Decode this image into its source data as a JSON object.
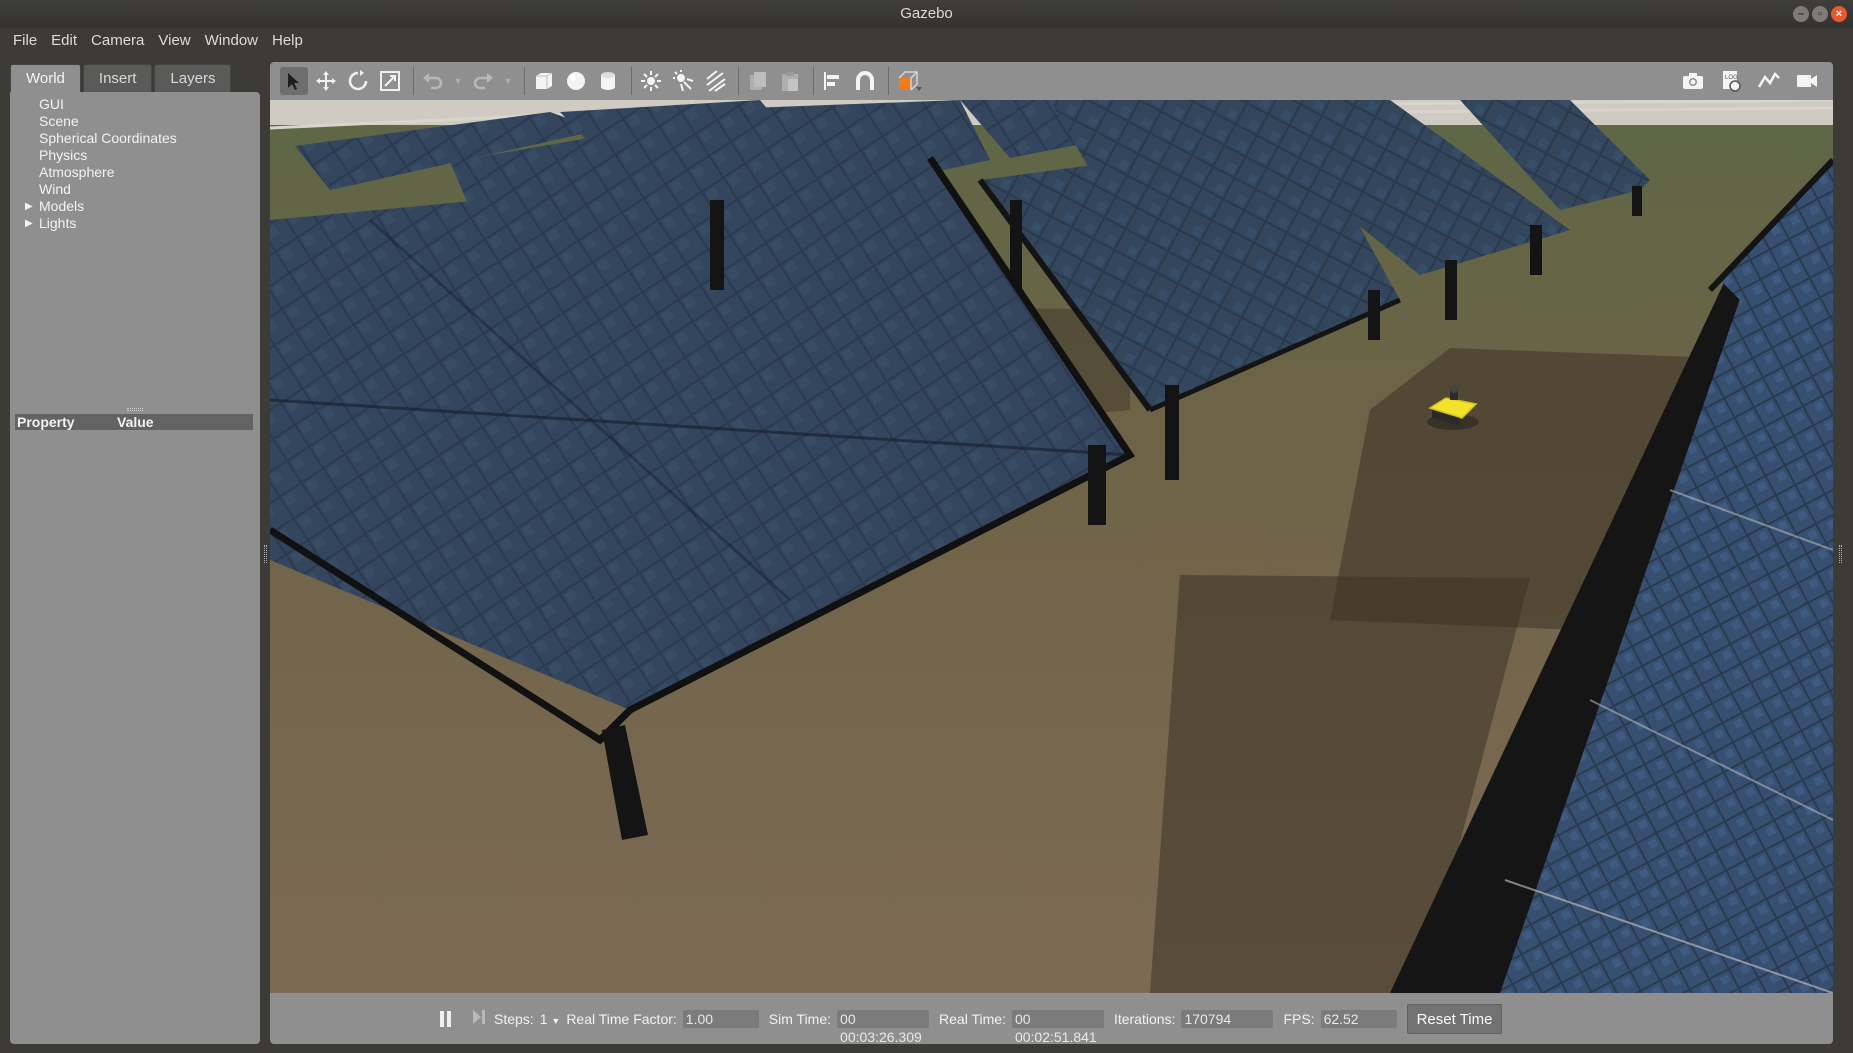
{
  "window": {
    "title": "Gazebo"
  },
  "menu": [
    {
      "label": "File"
    },
    {
      "label": "Edit"
    },
    {
      "label": "Camera"
    },
    {
      "label": "View"
    },
    {
      "label": "Window"
    },
    {
      "label": "Help"
    }
  ],
  "left_tabs": [
    {
      "label": "World"
    },
    {
      "label": "Insert"
    },
    {
      "label": "Layers"
    }
  ],
  "tree": [
    {
      "label": "GUI"
    },
    {
      "label": "Scene"
    },
    {
      "label": "Spherical Coordinates"
    },
    {
      "label": "Physics"
    },
    {
      "label": "Atmosphere"
    },
    {
      "label": "Wind"
    },
    {
      "label": "Models"
    },
    {
      "label": "Lights"
    }
  ],
  "properties": {
    "col_property": "Property",
    "col_value": "Value"
  },
  "toolbar": {
    "tools": [
      "select-mode-icon",
      "translate-mode-icon",
      "rotate-mode-icon",
      "scale-mode-icon",
      "undo-icon",
      "redo-icon",
      "box-icon",
      "sphere-icon",
      "cylinder-icon",
      "point-light-icon",
      "spot-light-icon",
      "directional-light-icon",
      "copy-icon",
      "paste-icon",
      "align-icon",
      "snap-icon",
      "view-angle-icon"
    ],
    "right_tools": [
      "screenshot-icon",
      "log-icon",
      "plot-icon",
      "video-record-icon"
    ]
  },
  "bottom": {
    "steps_label": "Steps:",
    "steps_value": "1",
    "rtf_label": "Real Time Factor:",
    "rtf_value": "1.00",
    "sim_label": "Sim Time:",
    "sim_value": "00 00:03:26.309",
    "real_label": "Real Time:",
    "real_value": "00 00:02:51.841",
    "iter_label": "Iterations:",
    "iter_value": "170794",
    "fps_label": "FPS:",
    "fps_value": "62.52",
    "reset_label": "Reset Time"
  },
  "colors": {
    "panel": "#8f8f8f",
    "chrome": "#3c3b37",
    "close": "#e9592d",
    "robot": "#f2e22a"
  }
}
